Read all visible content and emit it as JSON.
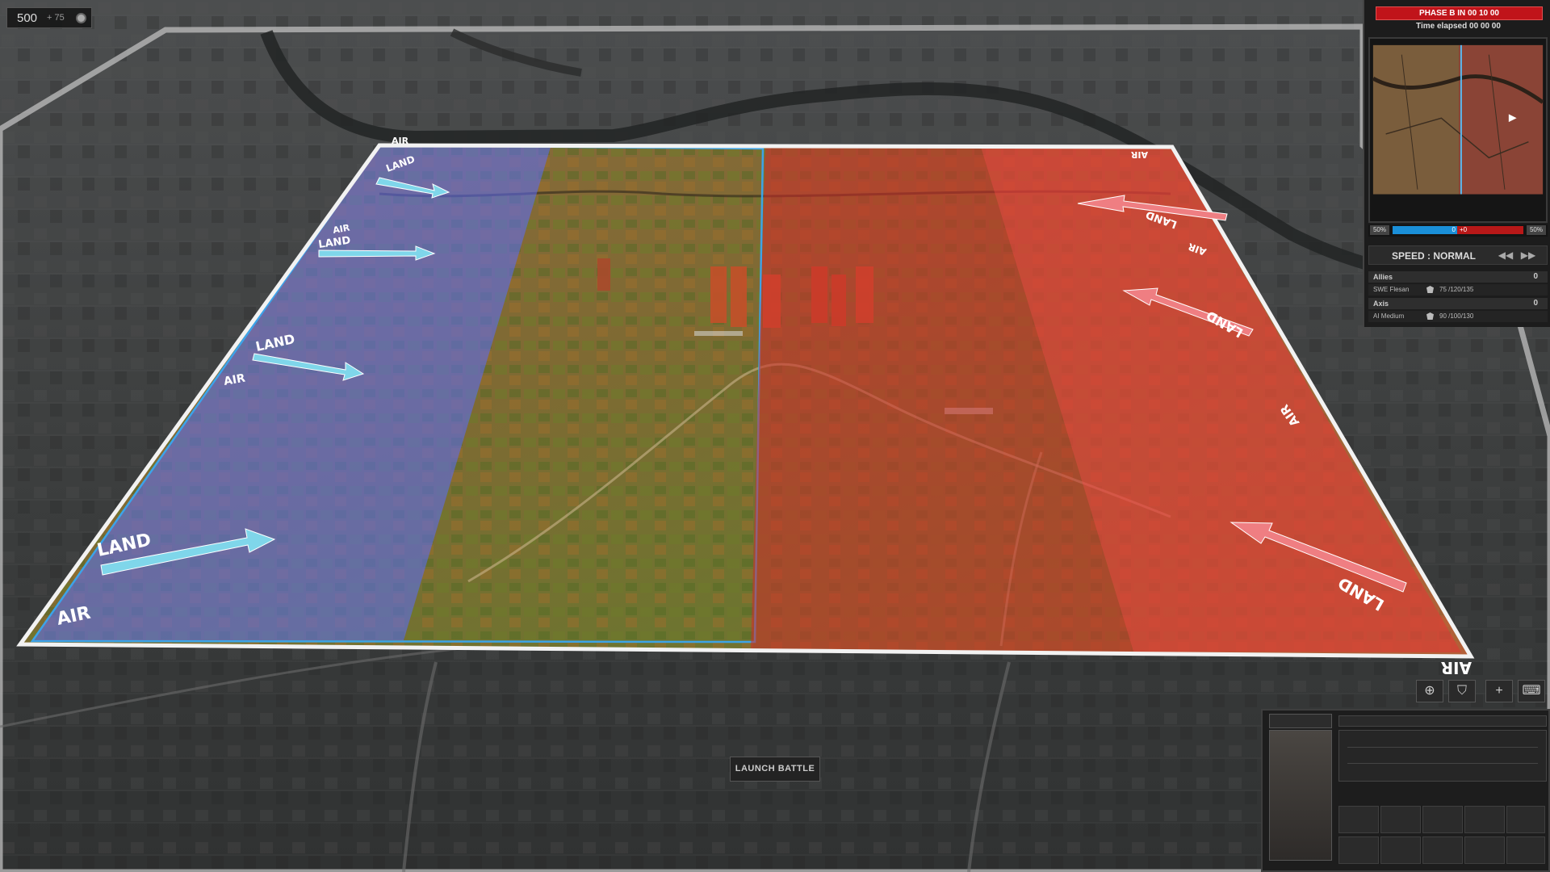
{
  "budget": {
    "value": "500",
    "income": "+ 75"
  },
  "status": {
    "phase": "PHASE B IN 00 10 00",
    "elapsed": "Time elapsed 00 00 00"
  },
  "force_ratio": {
    "allies_pct": "50%",
    "axis_pct": "50%",
    "allies_value": "0",
    "axis_value": "+0"
  },
  "speed": {
    "label": "SPEED : NORMAL",
    "slower": "◀◀",
    "faster": "▶▶"
  },
  "teams": [
    {
      "name": "Allies",
      "score": "0",
      "player": "SWE Flesan",
      "points": "75 /120/135"
    },
    {
      "name": "Axis",
      "score": "0",
      "player": "AI Medium",
      "points": "90 /100/130"
    }
  ],
  "map_labels": {
    "air": "AIR",
    "land": "LAND"
  },
  "launch_label": "LAUNCH BATTLE",
  "toolbar": [
    {
      "icon": "crosshair-icon",
      "glyph": "⊕"
    },
    {
      "icon": "shield-icon",
      "glyph": "⛉"
    },
    {
      "icon": "plus-icon",
      "glyph": "+"
    },
    {
      "icon": "keyboard-icon",
      "glyph": "⌨"
    }
  ],
  "colors": {
    "allies": "#5a78ff",
    "axis": "#e03030",
    "phase_banner": "#c0141a"
  }
}
